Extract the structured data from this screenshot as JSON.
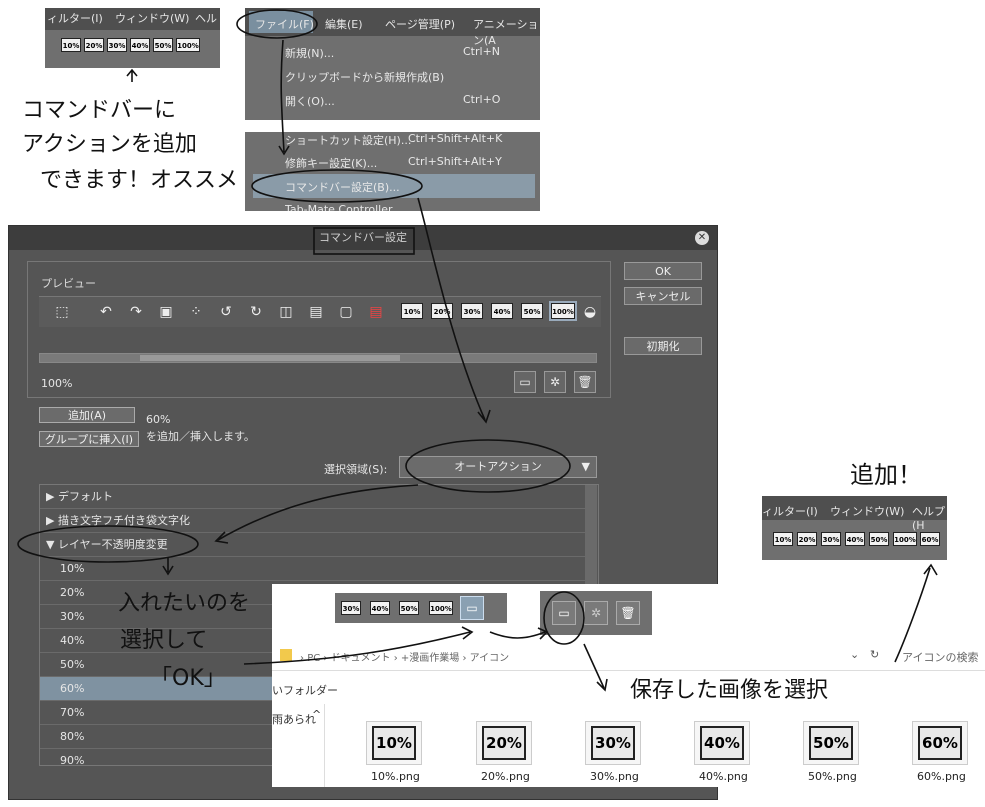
{
  "top_snippet": {
    "menu": [
      "ィルター(I)",
      "ウィンドウ(W)",
      "ヘル"
    ],
    "cmd_buttons": [
      "10%",
      "20%",
      "30%",
      "40%",
      "50%",
      "100%"
    ]
  },
  "file_menu": {
    "menubar": [
      "ファイル(F)",
      "編集(E)",
      "ページ管理(P)",
      "アニメーション(A"
    ],
    "items": [
      {
        "label": "新規(N)...",
        "shortcut": "Ctrl+N"
      },
      {
        "label": "クリップボードから新規作成(B)",
        "shortcut": ""
      },
      {
        "label": "開く(O)...",
        "shortcut": "Ctrl+O"
      },
      {
        "label": "ショートカット設定(H)...",
        "shortcut": "Ctrl+Shift+Alt+K"
      },
      {
        "label": "修飾キー設定(K)...",
        "shortcut": "Ctrl+Shift+Alt+Y"
      },
      {
        "label": "コマンドバー設定(B)...",
        "shortcut": ""
      },
      {
        "label": "Tab-Mate Controller",
        "shortcut": ""
      }
    ]
  },
  "dialog": {
    "title": "コマンドバー設定",
    "ok": "OK",
    "cancel": "キャンセル",
    "reset": "初期化",
    "preview_label": "プレビュー",
    "preview_pct_buttons": [
      "10%",
      "20%",
      "30%",
      "40%",
      "50%",
      "100%"
    ],
    "zoom": "100%",
    "add_button": "追加(A)",
    "insert_group_button": "グループに挿入(I)",
    "selected_name": "60%",
    "add_hint": "を追加／挿入します。",
    "select_area_label": "選択領域(S):",
    "select_area_value": "オートアクション",
    "tree_rows": [
      {
        "label": "デフォルト",
        "prefix": "▶"
      },
      {
        "label": "描き文字フチ付き袋文字化",
        "prefix": "▶"
      },
      {
        "label": "レイヤー不透明度変更",
        "prefix": "▼"
      },
      {
        "label": "10%",
        "prefix": ""
      },
      {
        "label": "20%",
        "prefix": ""
      },
      {
        "label": "30%",
        "prefix": ""
      },
      {
        "label": "40%",
        "prefix": ""
      },
      {
        "label": "50%",
        "prefix": ""
      },
      {
        "label": "60%",
        "prefix": ""
      },
      {
        "label": "70%",
        "prefix": ""
      },
      {
        "label": "80%",
        "prefix": ""
      },
      {
        "label": "90%",
        "prefix": ""
      }
    ]
  },
  "overlay": {
    "cmd_buttons": [
      "30%",
      "40%",
      "50%",
      "100%"
    ],
    "address_parts": [
      "PC",
      "ドキュメント",
      "+漫画作業場",
      "アイコン"
    ],
    "search_placeholder": "アイコンの検索",
    "folder_label": "いフォルダー",
    "side_text": "雨あられ",
    "files": [
      {
        "thumb": "10%",
        "name": "10%.png"
      },
      {
        "thumb": "20%",
        "name": "20%.png"
      },
      {
        "thumb": "30%",
        "name": "30%.png"
      },
      {
        "thumb": "40%",
        "name": "40%.png"
      },
      {
        "thumb": "50%",
        "name": "50%.png"
      },
      {
        "thumb": "60%",
        "name": "60%.png"
      }
    ]
  },
  "result": {
    "menu": [
      "ィルター(I)",
      "ウィンドウ(W)",
      "ヘルプ(H"
    ],
    "cmd_buttons": [
      "10%",
      "20%",
      "30%",
      "40%",
      "50%",
      "100%",
      "60%"
    ]
  },
  "notes": {
    "note1": [
      "コマンドバーに",
      "アクションを追加",
      "できます！オススメ"
    ],
    "note2": [
      "入れたいのを",
      "選択して",
      "「OK」"
    ],
    "note3": "保存した画像を選択",
    "note4": "追加！"
  }
}
